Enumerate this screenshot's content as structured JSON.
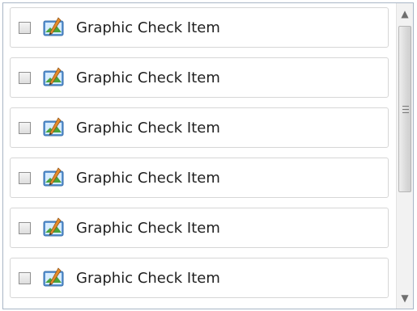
{
  "list": {
    "items": [
      {
        "label": "Graphic Check Item",
        "checked": false,
        "icon": "graphic-icon"
      },
      {
        "label": "Graphic Check Item",
        "checked": false,
        "icon": "graphic-icon"
      },
      {
        "label": "Graphic Check Item",
        "checked": false,
        "icon": "graphic-icon"
      },
      {
        "label": "Graphic Check Item",
        "checked": false,
        "icon": "graphic-icon"
      },
      {
        "label": "Graphic Check Item",
        "checked": false,
        "icon": "graphic-icon"
      },
      {
        "label": "Graphic Check Item",
        "checked": false,
        "icon": "graphic-icon"
      }
    ]
  },
  "scrollbar": {
    "up_arrow": "▲",
    "down_arrow": "▼",
    "position": 0.0
  },
  "colors": {
    "border": "#d6d6d6",
    "text": "#1f1f1f",
    "scrollbar_bg": "#f2f2f2"
  }
}
